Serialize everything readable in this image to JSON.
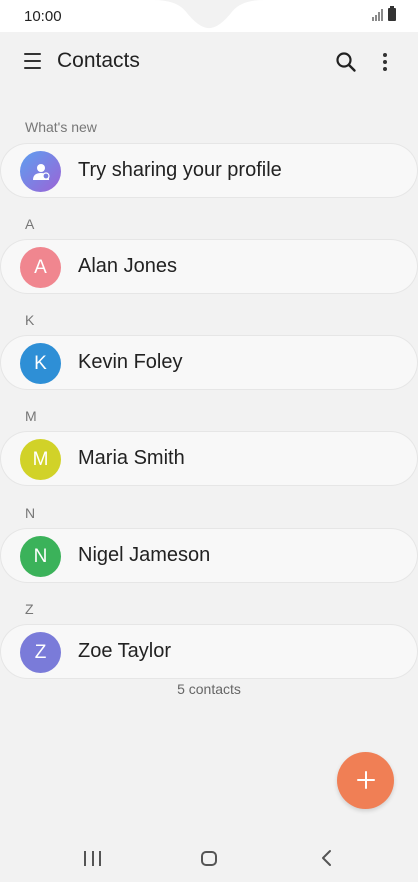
{
  "status_bar": {
    "time": "10:00"
  },
  "header": {
    "title": "Contacts",
    "menu_icon": "menu-icon",
    "search_icon": "search-icon",
    "more_icon": "more-options-icon"
  },
  "whats_new": {
    "section_label": "What's new",
    "item_label": "Try sharing your profile",
    "icon": "share-profile-icon"
  },
  "sections": [
    {
      "letter": "A",
      "name": "Alan Jones",
      "initial": "A",
      "color": "#f0868f"
    },
    {
      "letter": "K",
      "name": "Kevin Foley",
      "initial": "K",
      "color": "#2e8fd6"
    },
    {
      "letter": "M",
      "name": "Maria Smith",
      "initial": "M",
      "color": "#d1d228"
    },
    {
      "letter": "N",
      "name": "Nigel Jameson",
      "initial": "N",
      "color": "#3bb25a"
    },
    {
      "letter": "Z",
      "name": "Zoe Taylor",
      "initial": "Z",
      "color": "#7a7bd9"
    }
  ],
  "footer": {
    "count": "5 contacts"
  },
  "fab": {
    "icon": "add-icon",
    "color": "#f07f55"
  },
  "nav": {
    "recent_icon": "recent-apps-icon",
    "home_icon": "home-icon",
    "back_icon": "back-icon"
  }
}
